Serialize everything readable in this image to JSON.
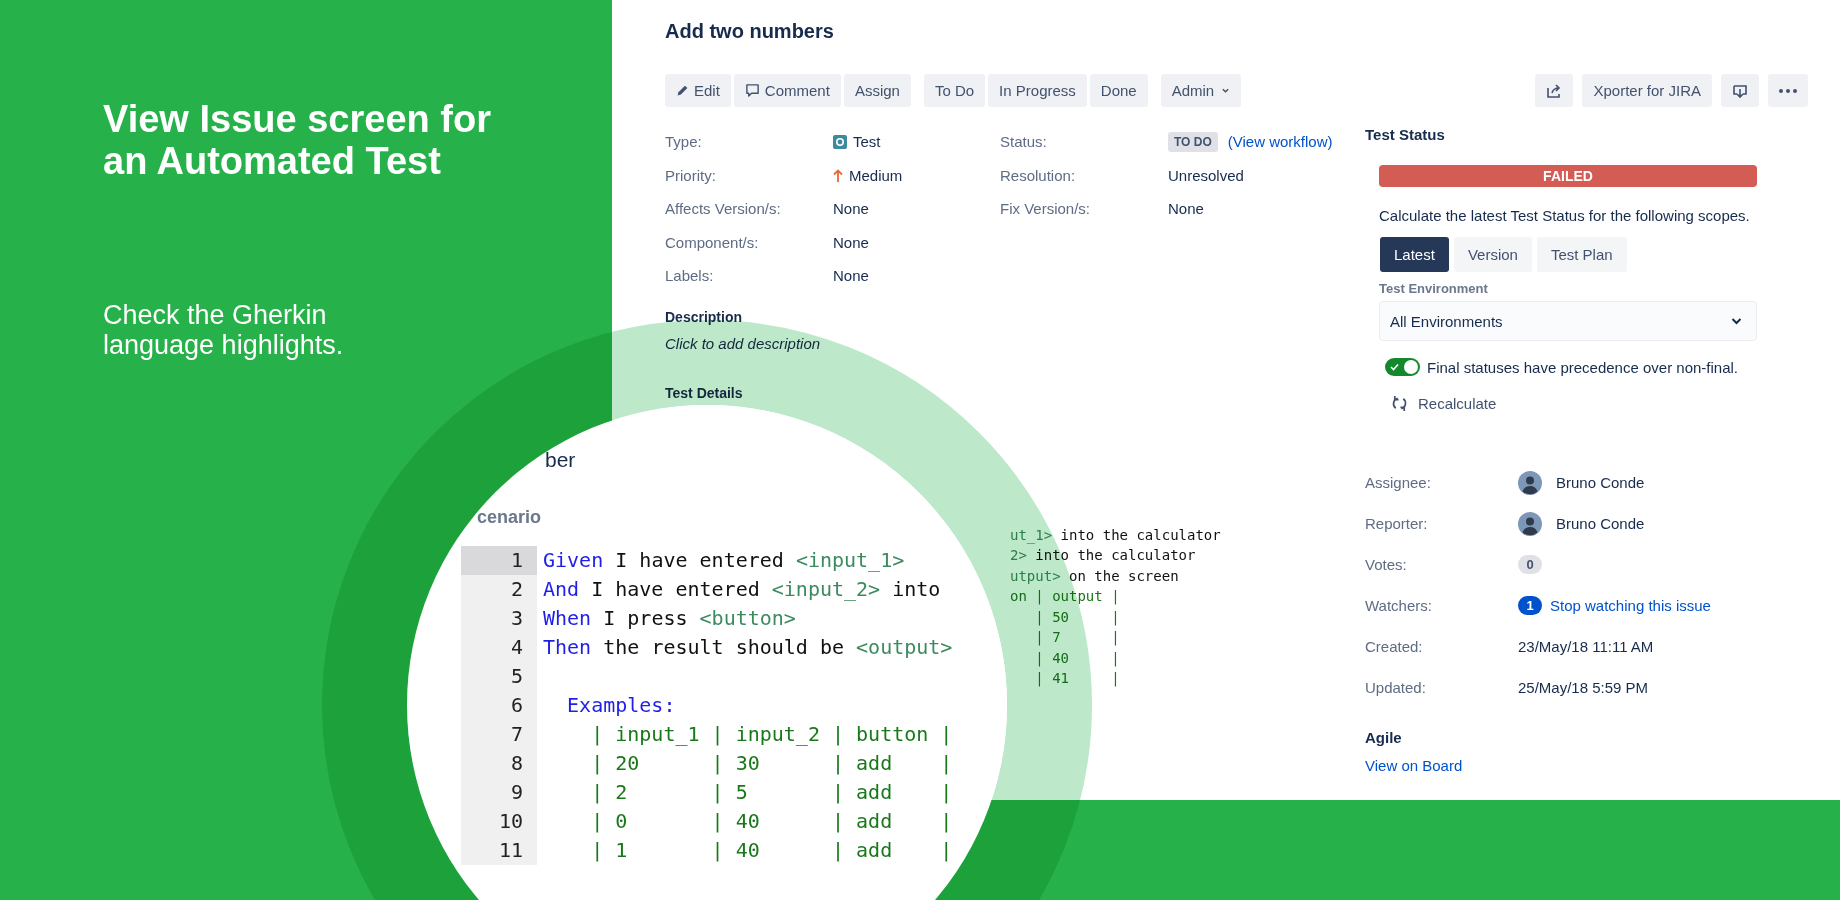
{
  "promo": {
    "title": "View Issue screen for an Automated Test",
    "subtitle": "Check the Gherkin language highlights."
  },
  "issue": {
    "title": "Add two numbers"
  },
  "toolbar": {
    "left_groups": [
      [
        {
          "kind": "edit",
          "label": "Edit"
        },
        {
          "kind": "comment",
          "label": "Comment"
        },
        {
          "kind": "text",
          "label": "Assign"
        }
      ],
      [
        {
          "kind": "text",
          "label": "To Do"
        },
        {
          "kind": "text",
          "label": "In Progress"
        },
        {
          "kind": "text",
          "label": "Done"
        }
      ],
      [
        {
          "kind": "menu",
          "label": "Admin"
        }
      ]
    ],
    "right_buttons": [
      {
        "kind": "share"
      },
      {
        "kind": "text",
        "label": "Xporter for JIRA"
      },
      {
        "kind": "download"
      },
      {
        "kind": "more"
      }
    ]
  },
  "details": {
    "left": [
      {
        "label": "Type:",
        "kind": "type",
        "value": "Test"
      },
      {
        "label": "Priority:",
        "kind": "priority",
        "value": "Medium"
      },
      {
        "label": "Affects Version/s:",
        "kind": "text",
        "value": "None"
      },
      {
        "label": "Component/s:",
        "kind": "text",
        "value": "None"
      },
      {
        "label": "Labels:",
        "kind": "text",
        "value": "None"
      }
    ],
    "right": [
      {
        "label": "Status:",
        "kind": "status",
        "value": "TO DO",
        "link": "(View workflow)"
      },
      {
        "label": "Resolution:",
        "kind": "text",
        "value": "Unresolved"
      },
      {
        "label": "Fix Version/s:",
        "kind": "text",
        "value": "None"
      }
    ]
  },
  "description": {
    "heading": "Description",
    "prompt": "Click to add description"
  },
  "test_details": {
    "heading": "Test Details",
    "code_preview": [
      {
        "tokens": [
          {
            "kind": "param",
            "text": "ut_1>"
          },
          {
            "kind": "plain",
            "text": " into the calculator"
          }
        ]
      },
      {
        "tokens": [
          {
            "kind": "param",
            "text": "2>"
          },
          {
            "kind": "plain",
            "text": " into the calculator"
          }
        ]
      },
      {
        "tokens": [
          {
            "kind": "param",
            "text": "utput>"
          },
          {
            "kind": "plain",
            "text": " on the screen"
          }
        ]
      },
      {
        "tokens": [
          {
            "kind": "table",
            "text": "on | output |"
          }
        ]
      },
      {
        "tokens": [
          {
            "kind": "table",
            "text": "   | 50     |"
          }
        ]
      },
      {
        "tokens": [
          {
            "kind": "table",
            "text": "   | 7      |"
          }
        ]
      },
      {
        "tokens": [
          {
            "kind": "table",
            "text": "   | 40     |"
          }
        ]
      },
      {
        "tokens": [
          {
            "kind": "table",
            "text": "   | 41     |"
          }
        ]
      }
    ]
  },
  "magnifier": {
    "heading": "ber",
    "section": "cenario",
    "lines": [
      {
        "number": "1",
        "current": true,
        "tokens": [
          {
            "kind": "keyword",
            "text": "Given"
          },
          {
            "kind": "plain",
            "text": " I have entered "
          },
          {
            "kind": "param",
            "text": "<input_1>"
          }
        ]
      },
      {
        "number": "2",
        "current": false,
        "tokens": [
          {
            "kind": "keyword",
            "text": "And"
          },
          {
            "kind": "plain",
            "text": " I have entered "
          },
          {
            "kind": "param",
            "text": "<input_2>"
          },
          {
            "kind": "plain",
            "text": " into"
          }
        ]
      },
      {
        "number": "3",
        "current": false,
        "tokens": [
          {
            "kind": "keyword",
            "text": "When"
          },
          {
            "kind": "plain",
            "text": " I press "
          },
          {
            "kind": "param",
            "text": "<button>"
          }
        ]
      },
      {
        "number": "4",
        "current": false,
        "tokens": [
          {
            "kind": "keyword",
            "text": "Then"
          },
          {
            "kind": "plain",
            "text": " the result should be "
          },
          {
            "kind": "param",
            "text": "<output>"
          }
        ]
      },
      {
        "number": "5",
        "current": false
      },
      {
        "number": "6",
        "current": false,
        "tokens": [
          {
            "kind": "keyword",
            "text": "  Examples:"
          }
        ]
      },
      {
        "number": "7",
        "current": false,
        "tokens": [
          {
            "kind": "table",
            "text": "    | input_1 | input_2 | button |"
          }
        ]
      },
      {
        "number": "8",
        "current": false,
        "tokens": [
          {
            "kind": "table",
            "text": "    | 20      | 30      | add    |"
          }
        ]
      },
      {
        "number": "9",
        "current": false,
        "tokens": [
          {
            "kind": "table",
            "text": "    | 2       | 5       | add    |"
          }
        ]
      },
      {
        "number": "10",
        "current": false,
        "tokens": [
          {
            "kind": "table",
            "text": "    | 0       | 40      | add    |"
          }
        ]
      },
      {
        "number": "11",
        "current": false,
        "tokens": [
          {
            "kind": "table",
            "text": "    | 1       | 40      | add    |"
          }
        ]
      }
    ]
  },
  "test_status": {
    "heading": "Test Status",
    "result": "FAILED",
    "description": "Calculate the latest Test Status for the following scopes.",
    "scopes": [
      {
        "label": "Latest",
        "selected": true
      },
      {
        "label": "Version",
        "selected": false
      },
      {
        "label": "Test Plan",
        "selected": false
      }
    ],
    "environment": {
      "label": "Test Environment",
      "value": "All Environments"
    },
    "toggle": {
      "label": "Final statuses have precedence over non-final.",
      "on": true
    },
    "recalculate": "Recalculate"
  },
  "people": [
    {
      "label": "Assignee:",
      "kind": "user",
      "value": "Bruno Conde"
    },
    {
      "label": "Reporter:",
      "kind": "user",
      "value": "Bruno Conde"
    },
    {
      "label": "Votes:",
      "kind": "count",
      "value": "0"
    },
    {
      "label": "Watchers:",
      "kind": "watch",
      "value": "1",
      "link": "Stop watching this issue"
    },
    {
      "label": "Created:",
      "kind": "text",
      "value": "23/May/18 11:11 AM"
    },
    {
      "label": "Updated:",
      "kind": "text",
      "value": "25/May/18 5:59 PM"
    }
  ],
  "agile": {
    "heading": "Agile",
    "link": "View on Board"
  }
}
